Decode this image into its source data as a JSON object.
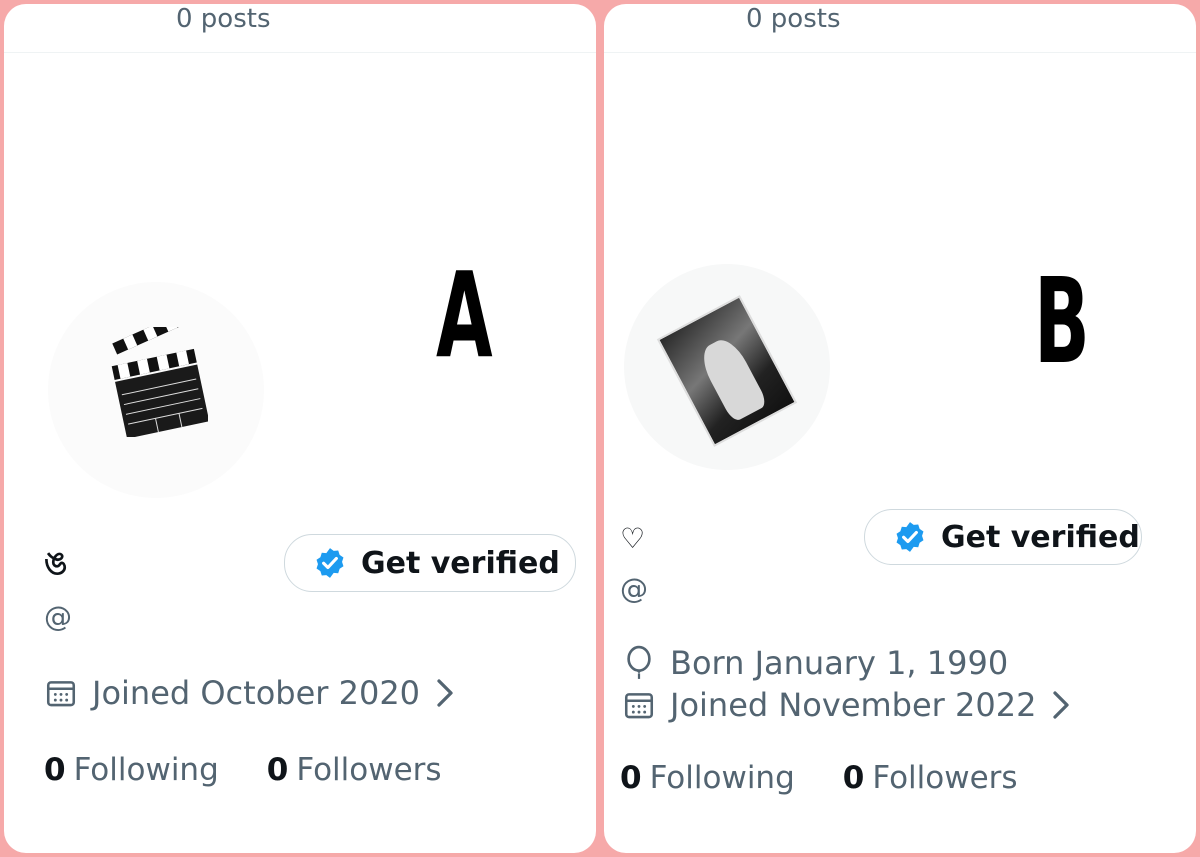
{
  "panels": [
    {
      "label": "A",
      "posts": "0 posts",
      "name": "ঙ",
      "handle": "@",
      "verify_label": "Get verified",
      "joined": "Joined October 2020",
      "following_count": "0",
      "following_label": "Following",
      "followers_count": "0",
      "followers_label": "Followers"
    },
    {
      "label": "B",
      "posts": "0 posts",
      "name": "♡",
      "handle": "@",
      "verify_label": "Get verified",
      "born": "Born January 1, 1990",
      "joined": "Joined November 2022",
      "following_count": "0",
      "following_label": "Following",
      "followers_count": "0",
      "followers_label": "Followers"
    }
  ],
  "colors": {
    "background": "#f6a9a9",
    "verified_blue": "#1d9bf0",
    "text_secondary": "#536471",
    "text_primary": "#0f1419"
  },
  "icons": {
    "avatar_a": "clapperboard-icon",
    "avatar_b": "magazine-cover-image",
    "badge": "verified-badge-icon",
    "calendar": "calendar-icon",
    "balloon": "balloon-icon",
    "chevron": "chevron-right-icon"
  }
}
